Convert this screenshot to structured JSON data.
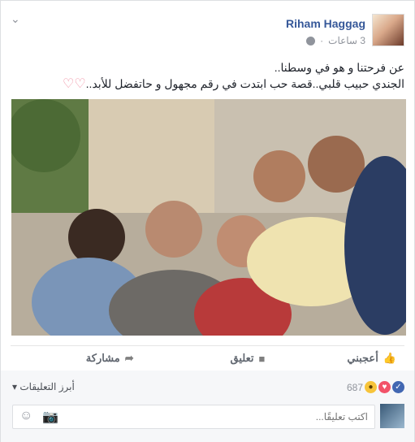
{
  "post": {
    "author": "Riham Haggag",
    "time": "3 ساعات",
    "text_line1": "عن فرحتنا و هو في وسطنا..",
    "text_line2": "الجندي حبيب قلبي..قصة حب ابتدت في رقم مجهول و حاتفضل للأبد..",
    "hearts": "♡♡"
  },
  "actions": {
    "like": "أعجبني",
    "comment": "تعليق",
    "share": "مشاركة"
  },
  "summary": {
    "reaction_count": "687",
    "top_comments": "أبرز التعليقات"
  },
  "comment_box": {
    "placeholder": "اكتب تعليقًا..."
  },
  "colors": {
    "link": "#365899",
    "like": "#4267b2",
    "love": "#f25268",
    "wow": "#f7c43a"
  }
}
